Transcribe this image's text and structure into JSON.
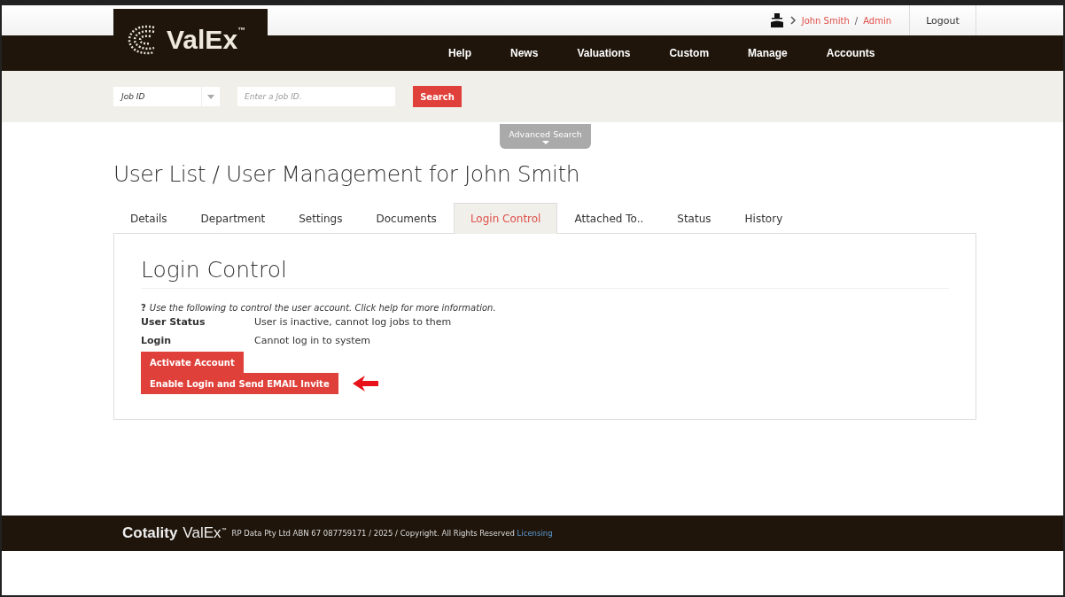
{
  "header": {
    "logo": "ValEx$^{™}$",
    "user_name": "John Smith",
    "separator": "/",
    "user_role": "Admin",
    "logout": "Logout"
  },
  "nav": [
    {
      "label": "Help"
    },
    {
      "label": "News"
    },
    {
      "label": "Valuations"
    },
    {
      "label": "Custom"
    },
    {
      "label": "Manage"
    },
    {
      "label": "Accounts"
    }
  ],
  "search": {
    "type_select": "Job ID",
    "placeholder": "Enter a Job ID.",
    "button": "Search",
    "advanced": "Advanced Search"
  },
  "page_title": "User List / User Management for John Smith",
  "tabs": [
    {
      "label": "Details",
      "selected": false
    },
    {
      "label": "Department",
      "selected": false
    },
    {
      "label": "Settings",
      "selected": false
    },
    {
      "label": "Documents",
      "selected": false
    },
    {
      "label": "Login Control",
      "selected": true
    },
    {
      "label": "Attached To..",
      "selected": false
    },
    {
      "label": "Status",
      "selected": false
    },
    {
      "label": "History",
      "selected": false
    }
  ],
  "panel": {
    "title": "Login Control",
    "help_mark": "?",
    "help_text": "Use the following to control the user account. Click help for more information.",
    "fields": [
      {
        "label": "User Status",
        "value": "User is inactive, cannot log jobs to them"
      },
      {
        "label": "Login",
        "value": "Cannot log in to system"
      }
    ],
    "buttons": [
      "Activate Account",
      "Enable Login and Send EMAIL Invite"
    ]
  },
  "footer": {
    "brand": "Cotality",
    "product": "ValEx$^{™}$",
    "text": "RP Data Pty Ltd ABN 67 087759171 / 2025 / Copyright. All Rights Reserved",
    "link": "Licensing"
  }
}
